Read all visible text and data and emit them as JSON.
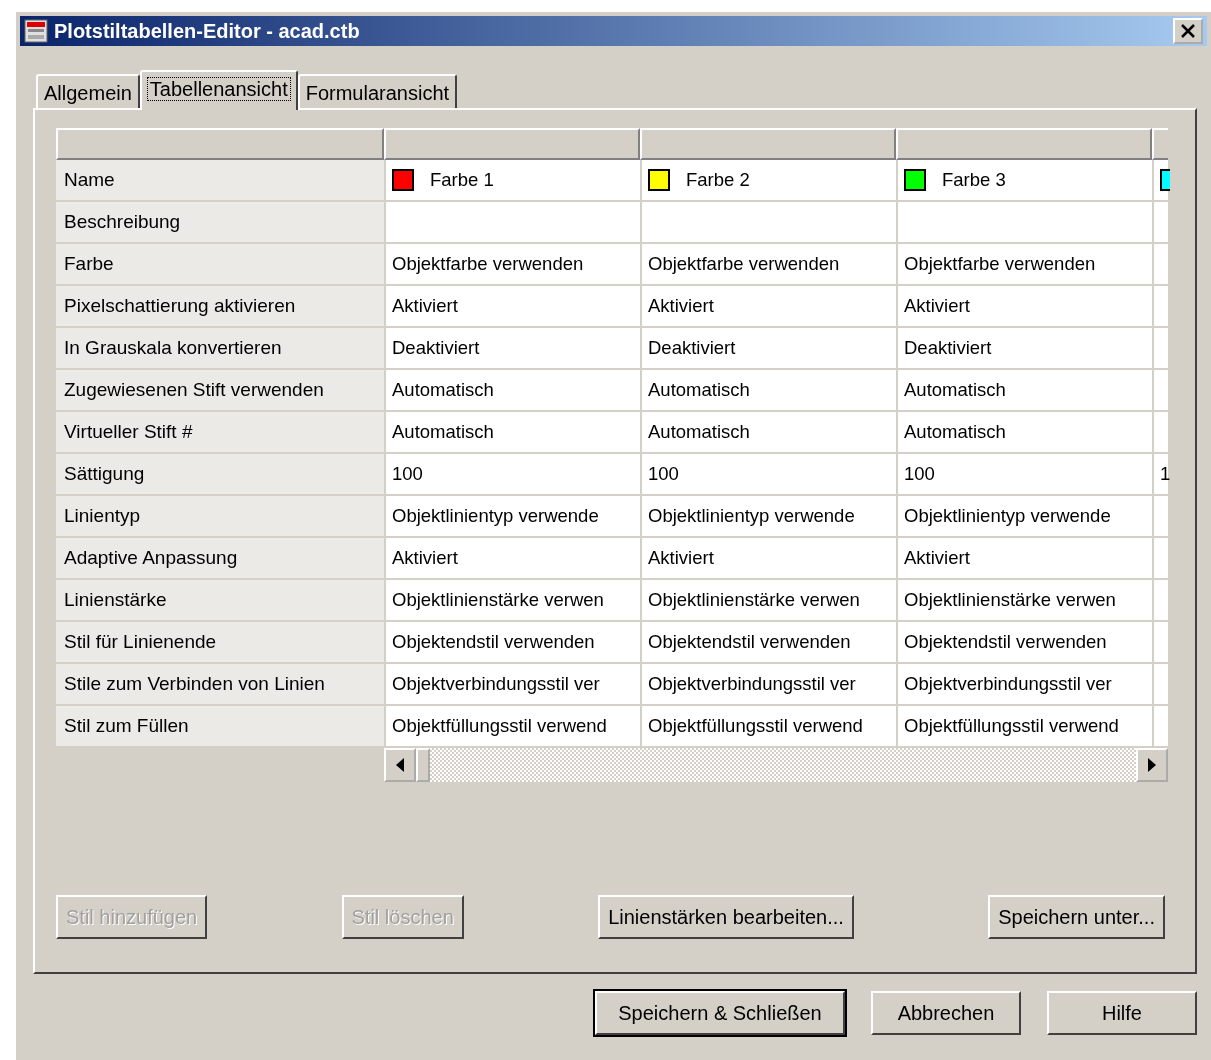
{
  "window": {
    "title": "Plotstiltabellen-Editor - acad.ctb"
  },
  "tabs": [
    {
      "label": "Allgemein",
      "selected": false
    },
    {
      "label": "Tabellenansicht",
      "selected": true
    },
    {
      "label": "Formularansicht",
      "selected": false
    }
  ],
  "table": {
    "styles": [
      {
        "name": "Farbe 1",
        "color": "#ff0000"
      },
      {
        "name": "Farbe 2",
        "color": "#ffff00"
      },
      {
        "name": "Farbe 3",
        "color": "#00ff00"
      },
      {
        "color": "#00ffff"
      }
    ],
    "rows": [
      {
        "label": "Beschreibung"
      },
      {
        "label": "Farbe",
        "values": [
          "Objektfarbe verwenden",
          "Objektfarbe verwenden",
          "Objektfarbe verwenden"
        ]
      },
      {
        "label": "Pixelschattierung aktivieren",
        "values": [
          "Aktiviert",
          "Aktiviert",
          "Aktiviert"
        ]
      },
      {
        "label": "In Grauskala konvertieren",
        "values": [
          "Deaktiviert",
          "Deaktiviert",
          "Deaktiviert"
        ]
      },
      {
        "label": "Zugewiesenen Stift verwenden",
        "values": [
          "Automatisch",
          "Automatisch",
          "Automatisch"
        ]
      },
      {
        "label": "Virtueller Stift #",
        "values": [
          "Automatisch",
          "Automatisch",
          "Automatisch"
        ]
      },
      {
        "label": "Sättigung",
        "values": [
          "100",
          "100",
          "100",
          "1"
        ]
      },
      {
        "label": "Linientyp",
        "values": [
          "Objektlinientyp verwende",
          "Objektlinientyp verwende",
          "Objektlinientyp verwende"
        ]
      },
      {
        "label": "Adaptive Anpassung",
        "values": [
          "Aktiviert",
          "Aktiviert",
          "Aktiviert"
        ]
      },
      {
        "label": "Linienstärke",
        "values": [
          "Objektlinienstärke verwen",
          "Objektlinienstärke verwen",
          "Objektlinienstärke verwen"
        ]
      },
      {
        "label": "Stil für Linienende",
        "values": [
          "Objektendstil verwenden",
          "Objektendstil verwenden",
          "Objektendstil verwenden"
        ]
      },
      {
        "label": "Stile zum Verbinden von Linien",
        "values": [
          "Objektverbindungsstil ver",
          "Objektverbindungsstil ver",
          "Objektverbindungsstil ver"
        ]
      },
      {
        "label": "Stil zum Füllen",
        "values": [
          "Objektfüllungsstil verwend",
          "Objektfüllungsstil verwend",
          "Objektfüllungsstil verwend"
        ]
      }
    ],
    "name_label": "Name"
  },
  "panel_buttons": [
    {
      "label": "Stil hinzufügen",
      "disabled": true
    },
    {
      "label": "Stil löschen",
      "disabled": true
    },
    {
      "label": "Linienstärken bearbeiten...",
      "disabled": false
    },
    {
      "label": "Speichern unter...",
      "disabled": false
    }
  ],
  "dialog_buttons": [
    {
      "label": "Speichern & Schließen",
      "default": true
    },
    {
      "label": "Abbrechen",
      "default": false
    },
    {
      "label": "Hilfe",
      "default": false
    }
  ]
}
